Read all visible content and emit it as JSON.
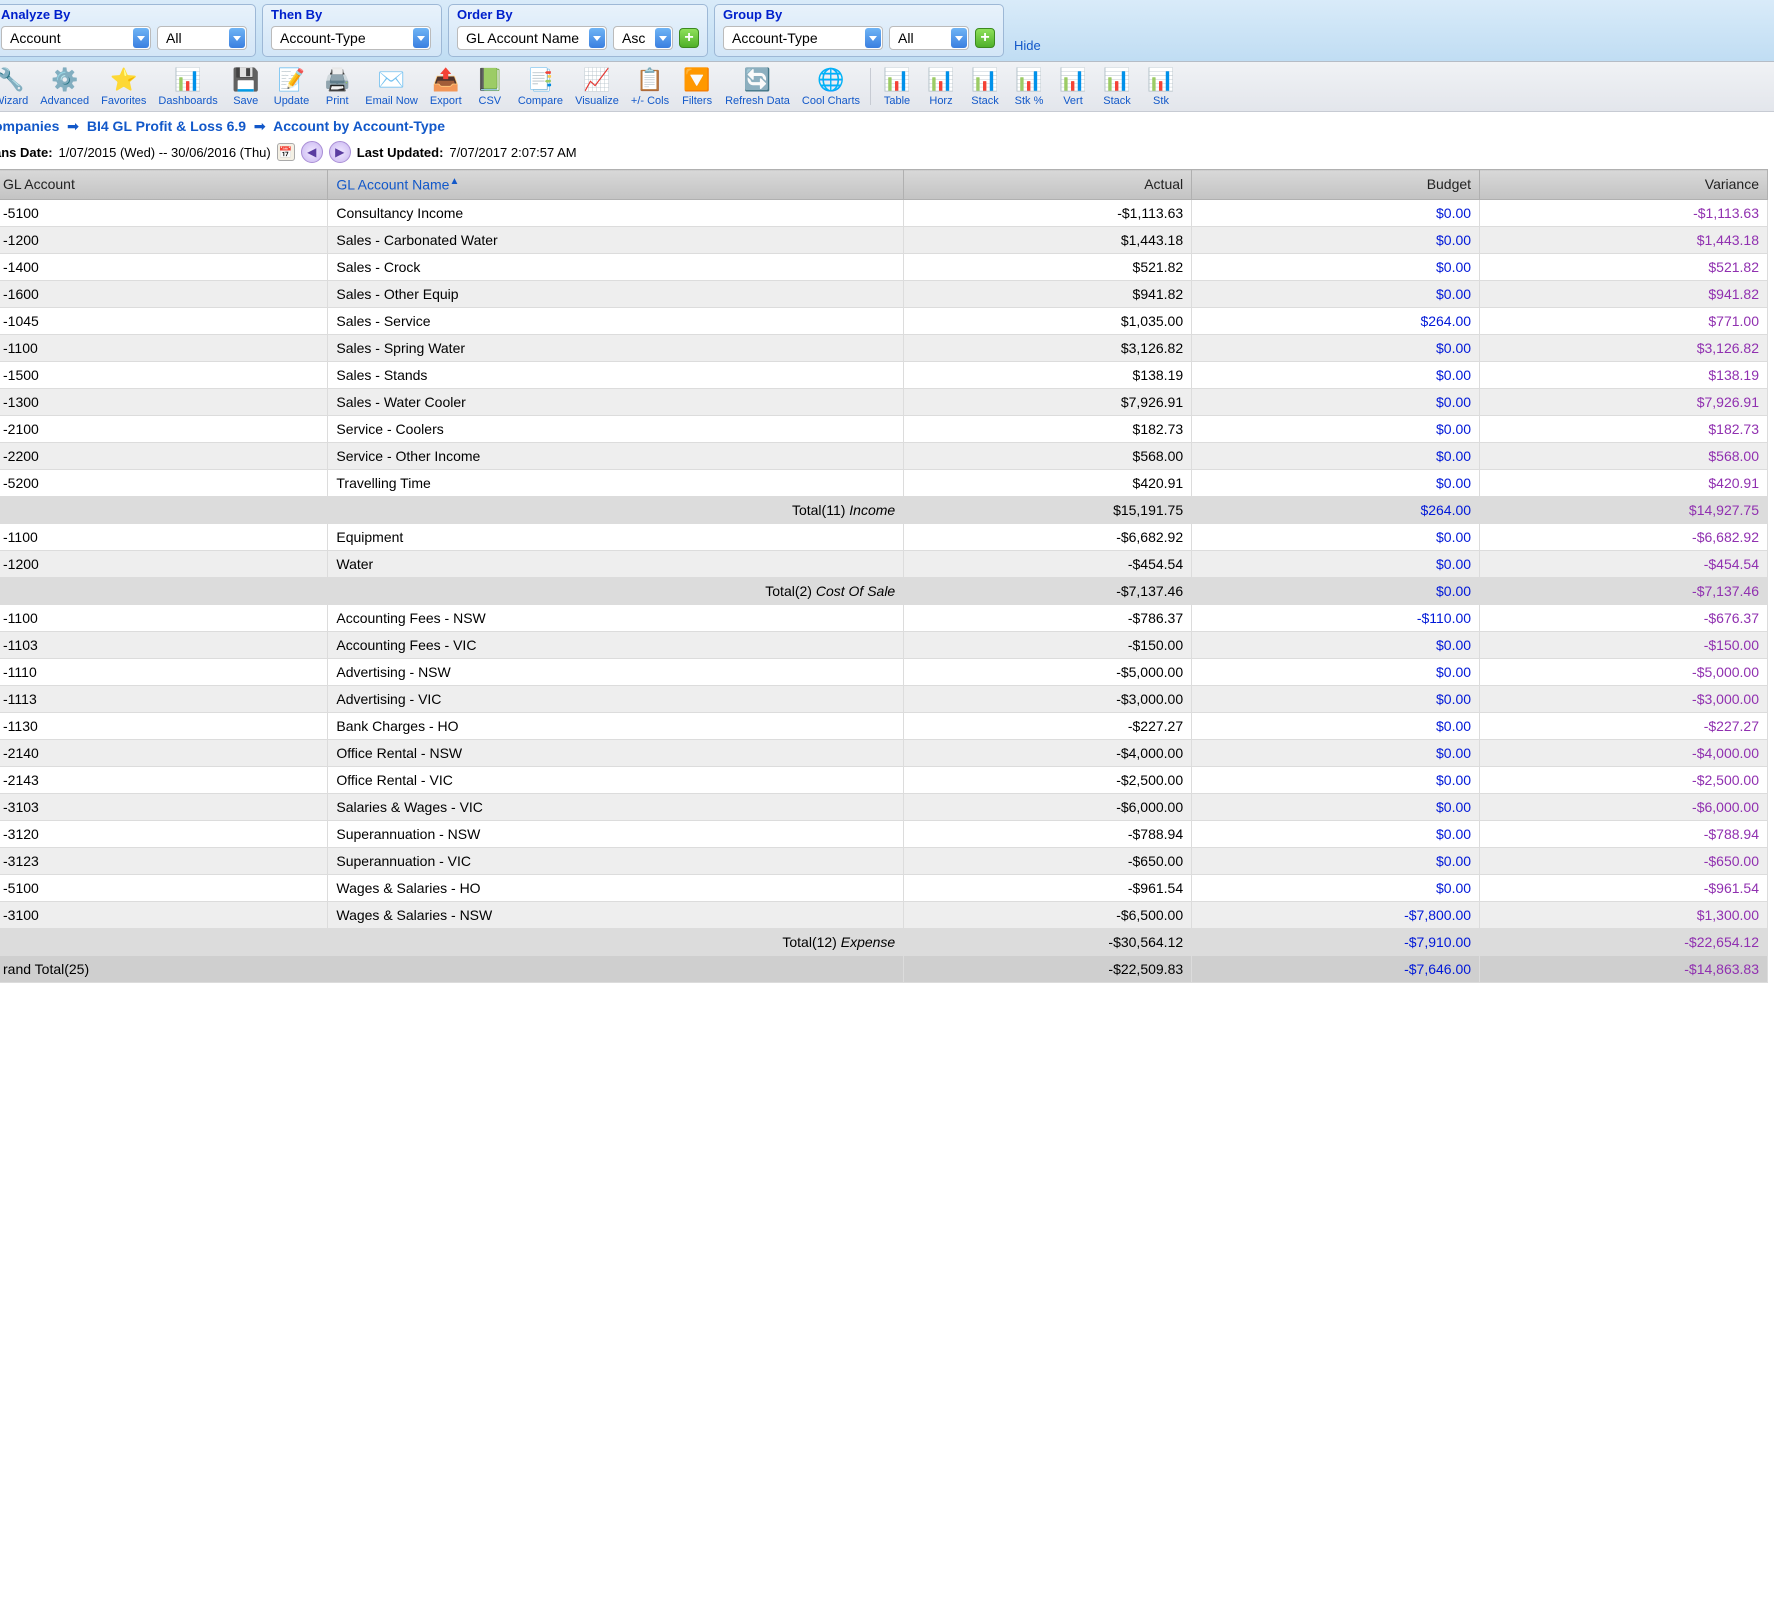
{
  "filters": {
    "analyze_by": {
      "label": "Analyze By",
      "value": "Account",
      "scope": "All"
    },
    "then_by": {
      "label": "Then By",
      "value": "Account-Type"
    },
    "order_by": {
      "label": "Order By",
      "value": "GL Account Name",
      "dir": "Asc"
    },
    "group_by": {
      "label": "Group By",
      "value": "Account-Type",
      "scope": "All"
    },
    "hide": "Hide"
  },
  "toolbar": [
    {
      "icon": "wrench",
      "label": "Wizard"
    },
    {
      "icon": "gear",
      "label": "Advanced"
    },
    {
      "icon": "star",
      "label": "Favorites"
    },
    {
      "icon": "dash",
      "label": "Dashboards"
    },
    {
      "icon": "save",
      "label": "Save"
    },
    {
      "icon": "update",
      "label": "Update"
    },
    {
      "icon": "print",
      "label": "Print"
    },
    {
      "icon": "email",
      "label": "Email Now"
    },
    {
      "icon": "export",
      "label": "Export"
    },
    {
      "icon": "excel",
      "label": "CSV"
    },
    {
      "icon": "compare",
      "label": "Compare"
    },
    {
      "icon": "viz",
      "label": "Visualize"
    },
    {
      "icon": "cols",
      "label": "+/- Cols"
    },
    {
      "icon": "filter",
      "label": "Filters"
    },
    {
      "icon": "refresh",
      "label": "Refresh Data"
    },
    {
      "icon": "cool",
      "label": "Cool Charts"
    }
  ],
  "toolbar2": [
    {
      "icon": "bars",
      "label": "Table"
    },
    {
      "icon": "bars",
      "label": "Horz"
    },
    {
      "icon": "bars",
      "label": "Stack"
    },
    {
      "icon": "bars",
      "label": "Stk %"
    },
    {
      "icon": "bars",
      "label": "Vert"
    },
    {
      "icon": "bars",
      "label": "Stack"
    },
    {
      "icon": "bars",
      "label": "Stk"
    }
  ],
  "breadcrumb": {
    "items": [
      "ompanies",
      "BI4 GL Profit & Loss 6.9",
      "Account by Account-Type"
    ]
  },
  "meta": {
    "trans_label": "ans Date:",
    "trans_value": "1/07/2015 (Wed) -- 30/06/2016 (Thu)",
    "updated_label": "Last Updated:",
    "updated_value": "7/07/2017 2:07:57 AM"
  },
  "columns": {
    "c0": "GL Account",
    "c1": "GL Account Name",
    "c2": "Actual",
    "c3": "Budget",
    "c4": "Variance"
  },
  "sections": [
    {
      "name": "Income",
      "rows": [
        {
          "code": "-5100",
          "name": "Consultancy Income",
          "actual": "-$1,113.63",
          "budget": "$0.00",
          "variance": "-$1,113.63"
        },
        {
          "code": "-1200",
          "name": "Sales - Carbonated Water",
          "actual": "$1,443.18",
          "budget": "$0.00",
          "variance": "$1,443.18"
        },
        {
          "code": "-1400",
          "name": "Sales - Crock",
          "actual": "$521.82",
          "budget": "$0.00",
          "variance": "$521.82"
        },
        {
          "code": "-1600",
          "name": "Sales - Other Equip",
          "actual": "$941.82",
          "budget": "$0.00",
          "variance": "$941.82"
        },
        {
          "code": "-1045",
          "name": "Sales - Service",
          "actual": "$1,035.00",
          "budget": "$264.00",
          "variance": "$771.00"
        },
        {
          "code": "-1100",
          "name": "Sales - Spring Water",
          "actual": "$3,126.82",
          "budget": "$0.00",
          "variance": "$3,126.82"
        },
        {
          "code": "-1500",
          "name": "Sales - Stands",
          "actual": "$138.19",
          "budget": "$0.00",
          "variance": "$138.19"
        },
        {
          "code": "-1300",
          "name": "Sales - Water Cooler",
          "actual": "$7,926.91",
          "budget": "$0.00",
          "variance": "$7,926.91"
        },
        {
          "code": "-2100",
          "name": "Service - Coolers",
          "actual": "$182.73",
          "budget": "$0.00",
          "variance": "$182.73"
        },
        {
          "code": "-2200",
          "name": "Service - Other Income",
          "actual": "$568.00",
          "budget": "$0.00",
          "variance": "$568.00"
        },
        {
          "code": "-5200",
          "name": "Travelling Time",
          "actual": "$420.91",
          "budget": "$0.00",
          "variance": "$420.91"
        }
      ],
      "total": {
        "label_prefix": "Total(11)",
        "label_group": "Income",
        "actual": "$15,191.75",
        "budget": "$264.00",
        "variance": "$14,927.75"
      }
    },
    {
      "name": "Cost Of Sale",
      "rows": [
        {
          "code": "-1100",
          "name": "Equipment",
          "actual": "-$6,682.92",
          "budget": "$0.00",
          "variance": "-$6,682.92"
        },
        {
          "code": "-1200",
          "name": "Water",
          "actual": "-$454.54",
          "budget": "$0.00",
          "variance": "-$454.54"
        }
      ],
      "total": {
        "label_prefix": "Total(2)",
        "label_group": "Cost Of Sale",
        "actual": "-$7,137.46",
        "budget": "$0.00",
        "variance": "-$7,137.46"
      }
    },
    {
      "name": "Expense",
      "rows": [
        {
          "code": "-1100",
          "name": "Accounting Fees - NSW",
          "actual": "-$786.37",
          "budget": "-$110.00",
          "variance": "-$676.37"
        },
        {
          "code": "-1103",
          "name": "Accounting Fees - VIC",
          "actual": "-$150.00",
          "budget": "$0.00",
          "variance": "-$150.00"
        },
        {
          "code": "-1110",
          "name": "Advertising - NSW",
          "actual": "-$5,000.00",
          "budget": "$0.00",
          "variance": "-$5,000.00"
        },
        {
          "code": "-1113",
          "name": "Advertising - VIC",
          "actual": "-$3,000.00",
          "budget": "$0.00",
          "variance": "-$3,000.00"
        },
        {
          "code": "-1130",
          "name": "Bank Charges - HO",
          "actual": "-$227.27",
          "budget": "$0.00",
          "variance": "-$227.27"
        },
        {
          "code": "-2140",
          "name": "Office Rental - NSW",
          "actual": "-$4,000.00",
          "budget": "$0.00",
          "variance": "-$4,000.00"
        },
        {
          "code": "-2143",
          "name": "Office Rental - VIC",
          "actual": "-$2,500.00",
          "budget": "$0.00",
          "variance": "-$2,500.00"
        },
        {
          "code": "-3103",
          "name": "Salaries & Wages - VIC",
          "actual": "-$6,000.00",
          "budget": "$0.00",
          "variance": "-$6,000.00"
        },
        {
          "code": "-3120",
          "name": "Superannuation - NSW",
          "actual": "-$788.94",
          "budget": "$0.00",
          "variance": "-$788.94"
        },
        {
          "code": "-3123",
          "name": "Superannuation - VIC",
          "actual": "-$650.00",
          "budget": "$0.00",
          "variance": "-$650.00"
        },
        {
          "code": "-5100",
          "name": "Wages & Salaries - HO",
          "actual": "-$961.54",
          "budget": "$0.00",
          "variance": "-$961.54"
        },
        {
          "code": "-3100",
          "name": "Wages & Salaries - NSW",
          "actual": "-$6,500.00",
          "budget": "-$7,800.00",
          "variance": "$1,300.00"
        }
      ],
      "total": {
        "label_prefix": "Total(12)",
        "label_group": "Expense",
        "actual": "-$30,564.12",
        "budget": "-$7,910.00",
        "variance": "-$22,654.12"
      }
    }
  ],
  "grand_total": {
    "label": "rand Total(25)",
    "actual": "-$22,509.83",
    "budget": "-$7,646.00",
    "variance": "-$14,863.83"
  }
}
